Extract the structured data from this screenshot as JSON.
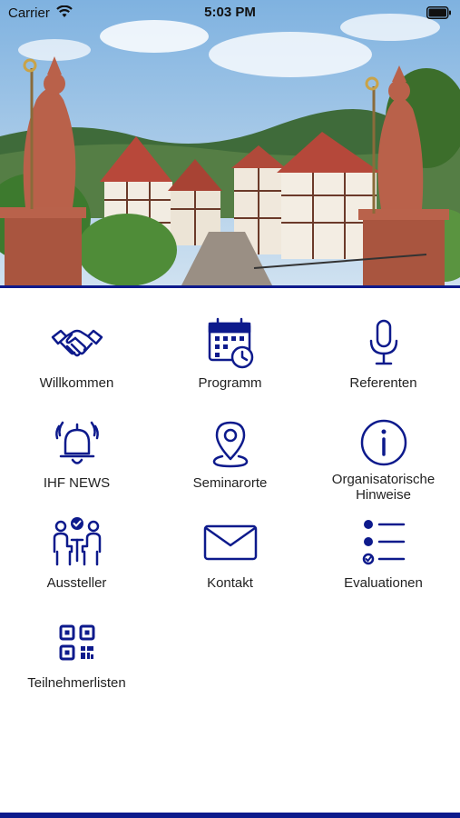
{
  "status_bar": {
    "carrier": "Carrier",
    "time": "5:03 PM"
  },
  "theme": {
    "accent": "#0d1a8c",
    "text": "#222222"
  },
  "menu": [
    {
      "label": "Willkommen",
      "icon": "handshake-icon"
    },
    {
      "label": "Programm",
      "icon": "calendar-clock-icon"
    },
    {
      "label": "Referenten",
      "icon": "microphone-icon"
    },
    {
      "label": "IHF NEWS",
      "icon": "bell-ringing-icon"
    },
    {
      "label": "Seminarorte",
      "icon": "map-pin-icon"
    },
    {
      "label": "Organisatorische\nHinweise",
      "icon": "info-circle-icon"
    },
    {
      "label": "Aussteller",
      "icon": "meeting-people-icon"
    },
    {
      "label": "Kontakt",
      "icon": "envelope-icon"
    },
    {
      "label": "Evaluationen",
      "icon": "checklist-icon"
    },
    {
      "label": "Teilnehmerlisten",
      "icon": "qr-code-icon"
    }
  ]
}
